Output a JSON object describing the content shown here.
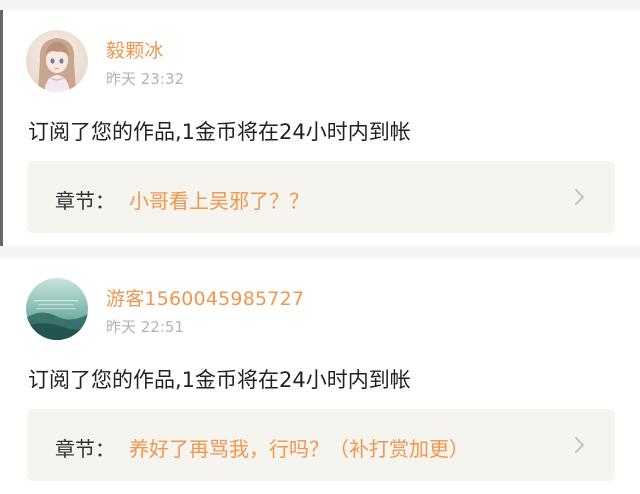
{
  "notifications": [
    {
      "username": "毅颗冰",
      "time": "昨天 23:32",
      "message": "订阅了您的作品,1金币将在24小时内到帐",
      "chapter_prefix": "章节：",
      "chapter_title": "小哥看上吴邪了？？",
      "avatar_icon": "anime-girl-avatar-icon"
    },
    {
      "username": "游客1560045985727",
      "time": "昨天 22:51",
      "message": "订阅了您的作品,1金币将在24小时内到帐",
      "chapter_prefix": "章节：",
      "chapter_title": "养好了再骂我，行吗？（补打赏加更）",
      "avatar_icon": "landscape-avatar-icon"
    }
  ],
  "colors": {
    "accent": "#f0964e",
    "timestamp": "#b3b3b3",
    "chapter_bg": "#f5f4ef",
    "page_bg": "#f4f4f4"
  }
}
